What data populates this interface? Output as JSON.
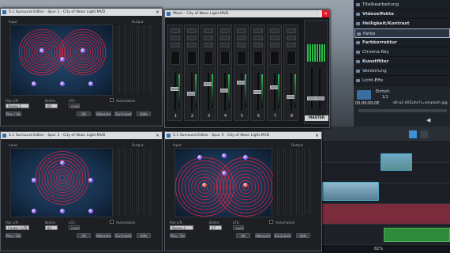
{
  "editor": {
    "right_panel": {
      "items": [
        {
          "label": "Titelbearbeitung",
          "bold": false
        },
        {
          "label": "Videoeffekte",
          "bold": true
        },
        {
          "label": "Helligkeit/Kontrast",
          "bold": true
        },
        {
          "label": "Farbe",
          "bold": false,
          "selected": true
        },
        {
          "label": "Farbkorrektur",
          "bold": true
        },
        {
          "label": "Chroma Key",
          "bold": false
        },
        {
          "label": "Kunstfilter",
          "bold": true
        },
        {
          "label": "Verzerrung",
          "bold": false
        },
        {
          "label": "Licht-Effe",
          "bold": false
        }
      ]
    },
    "preview": {
      "timecode": "00:00:00:0E",
      "unit": "Einheit:",
      "unit_value": "1/1",
      "clip_name": "qll-q1-dXZuhs?i=unsplash.jpg"
    }
  },
  "surround_windows": [
    {
      "title": "5.1 Surround Editor - Spur 1 - City of Neon Light.MVD",
      "input_label": "Input",
      "output_label": "Output",
      "pan_label": "Pan L/R:",
      "pan_value": "Stereo 2",
      "balance_label": "Breite:",
      "balance_value": "60",
      "lfe_label": "LFE:",
      "lfe_value": "mute",
      "automation_label": "Automation",
      "buttons": [
        "Play / Stop",
        "OK",
        "Abbrechen",
        "Zurücksetzen",
        "Hilfe"
      ]
    },
    {
      "title": "5.1 Surround Editor - Spur 3 - City of Neon Light.MVD",
      "input_label": "Input",
      "output_label": "Output",
      "pan_label": "Pan L/R:",
      "pan_value": "Center / LFE",
      "balance_label": "Breite:",
      "balance_value": "84",
      "lfe_label": "LFE:",
      "lfe_value": "mute",
      "automation_label": "Automation",
      "buttons": [
        "Play / Stop",
        "OK",
        "Abbrechen",
        "Zurücksetzen",
        "Hilfe"
      ]
    },
    {
      "title": "5.1 Surround Editor - Spur 5 - City of Neon Light.MVD",
      "input_label": "Input",
      "output_label": "Output",
      "pan_label": "Pan L/R:",
      "pan_value": "Stereo 3",
      "balance_label": "Breite:",
      "balance_value": "47",
      "lfe_label": "LFE:",
      "lfe_value": "mute",
      "automation_label": "Automation",
      "buttons": [
        "Play / Stop",
        "OK",
        "Abbrechen",
        "Zurücksetzen",
        "Hilfe"
      ]
    }
  ],
  "mixer": {
    "title": "Mixer - City of Neon Light.MVD",
    "channels": [
      "1",
      "2",
      "3",
      "4",
      "5",
      "6",
      "7",
      "8"
    ],
    "master_label": "MASTER"
  },
  "timeline": {
    "zoom": "82%"
  },
  "colors": {
    "ring": "#d8233f",
    "field": "#1a3350",
    "orb": "#8a5cf5",
    "accent": "#3c8fd8"
  }
}
